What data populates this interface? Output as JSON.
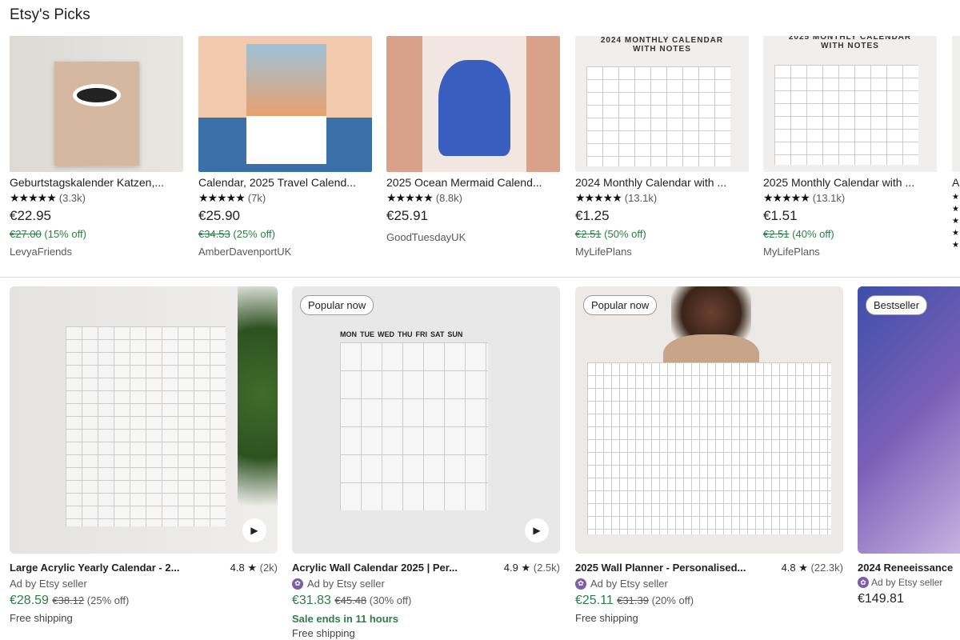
{
  "section_title": "Etsy's Picks",
  "top_items": [
    {
      "title": "Geburtstagskalender Katzen,...",
      "reviews": "(3.3k)",
      "price": "€22.95",
      "original": "€27.00",
      "discount": "(15% off)",
      "seller": "LevyaFriends"
    },
    {
      "title": "Calendar, 2025 Travel Calend...",
      "reviews": "(7k)",
      "price": "€25.90",
      "original": "€34.53",
      "discount": "(25% off)",
      "seller": "AmberDavenportUK"
    },
    {
      "title": "2025 Ocean Mermaid Calend...",
      "reviews": "(8.8k)",
      "price": "€25.91",
      "seller": "GoodTuesdayUK"
    },
    {
      "title": "2024 Monthly Calendar with ...",
      "reviews": "(13.1k)",
      "price": "€1.25",
      "original": "€2.51",
      "discount": "(50% off)",
      "seller": "MyLifePlans",
      "image_heading": "2024 MONTHLY CALENDAR WITH NOTES"
    },
    {
      "title": "2025 Monthly Calendar with ...",
      "reviews": "(13.1k)",
      "price": "€1.51",
      "original": "€2.51",
      "discount": "(40% off)",
      "seller": "MyLifePlans",
      "image_heading": "2025 MONTHLY CALENDAR WITH NOTES"
    },
    {
      "title": "A"
    }
  ],
  "stars": "★★★★★",
  "bottom_items": [
    {
      "title": "Large Acrylic Yearly Calendar - 2...",
      "rating": "4.8",
      "reviews": "(2k)",
      "ad": "Ad by Etsy seller",
      "price": "€28.59",
      "original": "€38.12",
      "discount": "(25% off)",
      "shipping": "Free shipping",
      "has_video": true
    },
    {
      "badge": "Popular now",
      "title": "Acrylic Wall Calendar 2025 | Per...",
      "rating": "4.9",
      "reviews": "(2.5k)",
      "ad": "Ad by Etsy seller",
      "price": "€31.83",
      "original": "€45.48",
      "discount": "(30% off)",
      "sale": "Sale ends in 11 hours",
      "shipping": "Free shipping",
      "has_video": true,
      "image_days": [
        "MON",
        "TUE",
        "WED",
        "THU",
        "FRI",
        "SAT",
        "SUN"
      ]
    },
    {
      "badge": "Popular now",
      "title": "2025 Wall Planner - Personalised...",
      "rating": "4.8",
      "reviews": "(22.3k)",
      "ad": "Ad by Etsy seller",
      "price": "€25.11",
      "original": "€31.39",
      "discount": "(20% off)",
      "shipping": "Free shipping"
    },
    {
      "badge": "Bestseller",
      "title": "2024 Reneeissance",
      "ad": "Ad by Etsy seller",
      "price": "€149.81"
    }
  ],
  "colors": {
    "sale_green": "#2f7d4a",
    "ad_purple": "#7b5ea7"
  }
}
